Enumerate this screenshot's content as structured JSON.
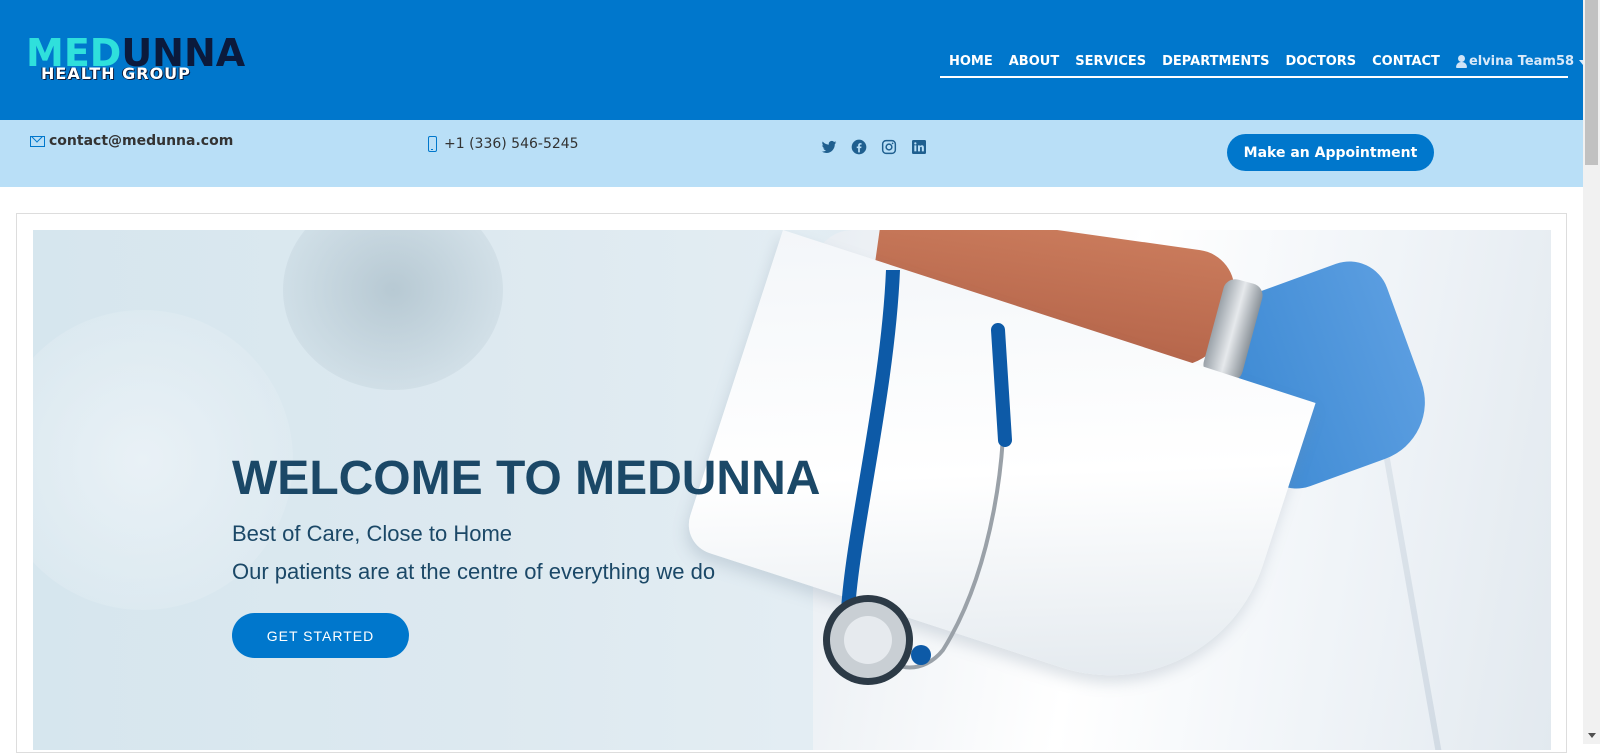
{
  "brand": {
    "logo_part1": "MED",
    "logo_part2": "UNNA",
    "logo_tagline": "HEALTH GROUP",
    "colors": {
      "primary": "#0077cc",
      "light_bar": "#b9dff7",
      "logo_cyan": "#2fe0dc",
      "logo_navy": "#0b1a3c",
      "hero_text": "#1b4867"
    }
  },
  "nav": {
    "items": [
      {
        "label": "HOME"
      },
      {
        "label": "ABOUT"
      },
      {
        "label": "SERVICES"
      },
      {
        "label": "DEPARTMENTS"
      },
      {
        "label": "DOCTORS"
      },
      {
        "label": "CONTACT"
      }
    ],
    "user": {
      "icon": "user-icon",
      "name": "elvina Team58"
    }
  },
  "topbar": {
    "email": {
      "icon": "envelope-icon",
      "text": "contact@medunna.com"
    },
    "phone": {
      "icon": "mobile-phone-icon",
      "text": "+1 (336) 546-5245"
    },
    "socials": [
      {
        "icon": "twitter-icon"
      },
      {
        "icon": "facebook-icon"
      },
      {
        "icon": "instagram-icon"
      },
      {
        "icon": "linkedin-icon"
      }
    ],
    "appointment_label": "Make an Appointment"
  },
  "hero": {
    "title": "WELCOME TO MEDUNNA",
    "subtitle": "Best of Care, Close to Home",
    "subtitle2": "Our patients are at the centre of everything we do",
    "cta_label": "GET STARTED"
  }
}
